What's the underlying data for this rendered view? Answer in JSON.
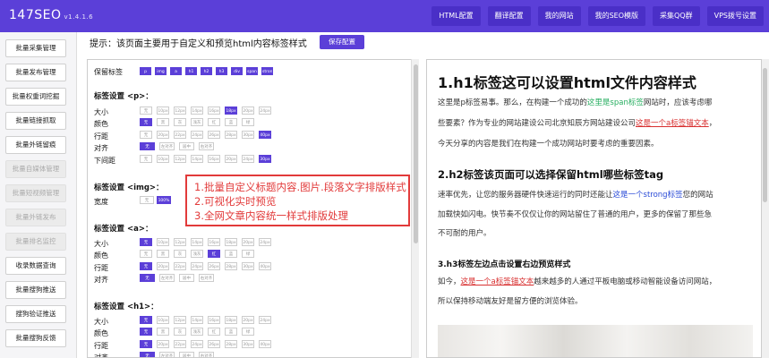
{
  "app": {
    "brand": "147SEO",
    "version": "v1.4.1.6"
  },
  "topnav": [
    "HTML配置",
    "翻译配置",
    "我的网站",
    "我的SEO模版",
    "采集QQ群",
    "VPS拨号设置"
  ],
  "sidebar": [
    {
      "label": "批量采集管理",
      "disabled": false
    },
    {
      "label": "批量发布管理",
      "disabled": false
    },
    {
      "label": "批量权重词挖掘",
      "disabled": false
    },
    {
      "label": "批量链接抓取",
      "disabled": false
    },
    {
      "label": "批量外链留痕",
      "disabled": false
    },
    {
      "label": "批量自媒体管理",
      "disabled": true
    },
    {
      "label": "批量短视频管理",
      "disabled": true
    },
    {
      "label": "批量外链发布",
      "disabled": true
    },
    {
      "label": "批量排名监控",
      "disabled": true
    },
    {
      "label": "收录数据查询",
      "disabled": false
    },
    {
      "label": "批量搜狗推送",
      "disabled": false
    },
    {
      "label": "搜狗验证推送",
      "disabled": false
    },
    {
      "label": "批量搜狗反馈",
      "disabled": false
    }
  ],
  "hint": "提示：该页面主要用于自定义和预览html内容标签样式",
  "save_label": "保存配置",
  "settings": {
    "keep_tags_label": "保留标签",
    "keep_tags": [
      "p",
      "img",
      "a",
      "h1",
      "h2",
      "h3",
      "div",
      "span",
      "strong"
    ],
    "p": {
      "title": "标签设置 <p>：",
      "size_label": "大小",
      "size": [
        "无",
        "10px",
        "12px",
        "14px",
        "16px",
        "18px",
        "20px",
        "24px"
      ],
      "size_on": "18px",
      "color_label": "颜色",
      "color": [
        "无",
        "黑",
        "灰",
        "浅灰",
        "红",
        "蓝",
        "绿"
      ],
      "color_on": "无",
      "lh_label": "行距",
      "lh": [
        "无",
        "20px",
        "22px",
        "24px",
        "26px",
        "28px",
        "30px",
        "40px"
      ],
      "lh_on": "40px",
      "align_label": "对齐",
      "align": [
        "无",
        "左对齐",
        "居中",
        "右对齐"
      ],
      "align_on": "无",
      "mb_label": "下间距",
      "mb": [
        "无",
        "10px",
        "12px",
        "14px",
        "16px",
        "20px",
        "24px",
        "30px"
      ],
      "mb_on": "30px"
    },
    "img": {
      "title": "标签设置 <img>：",
      "width_label": "宽度",
      "width": [
        "无",
        "100%"
      ],
      "width_on": "100%"
    },
    "a": {
      "title": "标签设置 <a>：",
      "size_label": "大小",
      "size": [
        "无",
        "10px",
        "12px",
        "14px",
        "16px",
        "18px",
        "20px",
        "24px"
      ],
      "size_on": "无",
      "color_label": "颜色",
      "color": [
        "无",
        "黑",
        "灰",
        "浅灰",
        "红",
        "蓝",
        "绿"
      ],
      "color_on": "红",
      "lh_label": "行距",
      "lh": [
        "无",
        "20px",
        "22px",
        "24px",
        "26px",
        "28px",
        "30px",
        "40px"
      ],
      "lh_on": "无",
      "align_label": "对齐",
      "align": [
        "无",
        "左对齐",
        "居中",
        "右对齐"
      ],
      "align_on": "无"
    },
    "h1": {
      "title": "标签设置 <h1>：",
      "size_label": "大小",
      "size": [
        "无",
        "10px",
        "12px",
        "14px",
        "16px",
        "18px",
        "20px",
        "24px"
      ],
      "size_on": "无",
      "color_label": "颜色",
      "color": [
        "无",
        "黑",
        "灰",
        "浅灰",
        "红",
        "蓝",
        "绿"
      ],
      "color_on": "无",
      "lh_label": "行距",
      "lh": [
        "无",
        "20px",
        "22px",
        "24px",
        "26px",
        "28px",
        "30px",
        "40px"
      ],
      "lh_on": "无",
      "align_label": "对齐",
      "align": [
        "无",
        "左对齐",
        "居中",
        "右对齐"
      ],
      "align_on": "无"
    }
  },
  "callout": [
    "1.批量自定义标题内容.图片.段落文字排版样式",
    "2.可视化实时预览",
    "3.全网文章内容统一样式排版处理"
  ],
  "preview": {
    "h1": "1.h1标签这可以设置html文件内容样式",
    "p1_a": "这里是p标签易事。那么，在构建一个成功的",
    "p1_hl": "这里是span标签",
    "p1_b": "网站时，应该考虑哪",
    "p2_a": "些要素？作为专业的网站建设公司北京知辰方网站建设公司",
    "p2_lk": "这是一个a标签锚文本",
    "p2_b": "，",
    "p3": "今天分享的内容是我们在构建一个成功网站时要考虑的重要因素。",
    "h2": "2.h2标签该页面可以选择保留html哪些标签tag",
    "p4_a": "速率优先，让您的服务器硬件快速运行的同时还能让",
    "p4_bl": "这是一个strong标签",
    "p4_b": "您的网站",
    "p5": "加载快如闪电。快节奏不仅仅让你的网站留住了普通的用户，更多的保留了那些急",
    "p6": "不可耐的用户。",
    "h3": "3.h3标签左边点击设置右边预览样式",
    "p7_a": "如今，",
    "p7_lk": "这是一个a标签锚文本",
    "p7_b": "越来越多的人通过平板电脑或移动智能设备访问网站，",
    "p8": "所以保持移动端友好是留方便的浏览体验。"
  },
  "colors": {
    "accent": "#5b3fd8",
    "callout": "#e23a3a",
    "span": "#27ae60",
    "link": "#d83030",
    "strong": "#2a4bd7"
  }
}
